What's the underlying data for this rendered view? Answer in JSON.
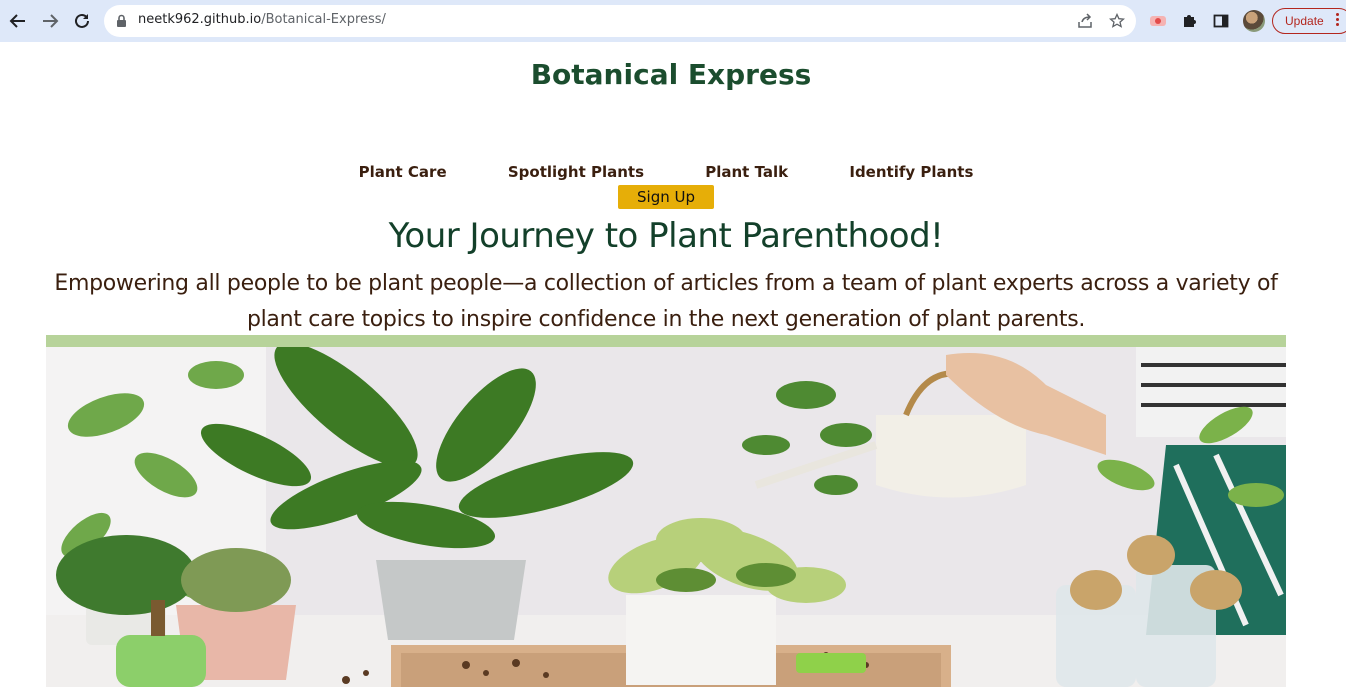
{
  "browser": {
    "url_host": "neetk962.github.io",
    "url_path": "/Botanical-Express/",
    "update_label": "Update",
    "icons": [
      "back-arrow-icon",
      "forward-arrow-icon",
      "reload-icon",
      "lock-icon",
      "share-icon",
      "star-icon",
      "extension-record-icon",
      "puzzle-icon",
      "side-panel-icon",
      "profile-avatar",
      "kebab-menu-icon"
    ]
  },
  "page": {
    "title": "Botanical Express",
    "nav": [
      "Plant Care",
      "Spotlight Plants",
      "Plant Talk",
      "Identify Plants"
    ],
    "signup_label": "Sign Up",
    "hero_title": "Your Journey to Plant Parenthood!",
    "hero_subtitle": "Empowering all people to be plant people—a collection of articles from a team of plant experts across a variety of plant care topics to inspire confidence in the next generation of plant parents."
  },
  "colors": {
    "title_green": "#1b4d2e",
    "text_brown": "#3a1f0f",
    "signup_yellow": "#e6ae08",
    "band_green": "#b7d39a",
    "chrome_bg": "#dee8f9"
  }
}
